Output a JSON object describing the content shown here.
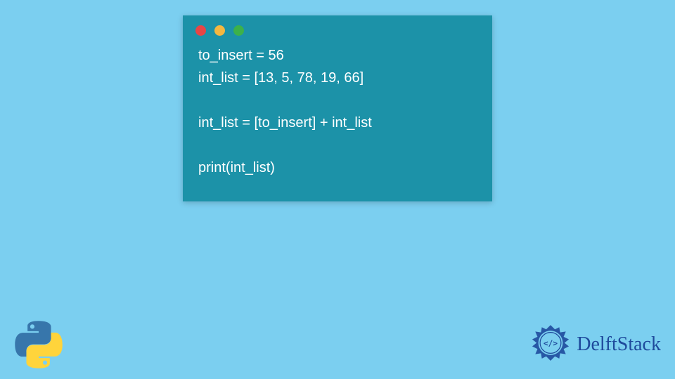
{
  "code_window": {
    "lines": [
      "to_insert = 56",
      "int_list = [13, 5, 78, 19, 66]",
      "",
      "int_list = [to_insert] + int_list",
      "",
      "print(int_list)"
    ]
  },
  "branding": {
    "site_name": "DelftStack"
  },
  "colors": {
    "background": "#7BCFF0",
    "window_bg": "#1C92A8",
    "code_text": "#FFFFFF",
    "brand_text": "#1E4A9C",
    "python_blue": "#3776AB",
    "python_yellow": "#FFD43B"
  }
}
